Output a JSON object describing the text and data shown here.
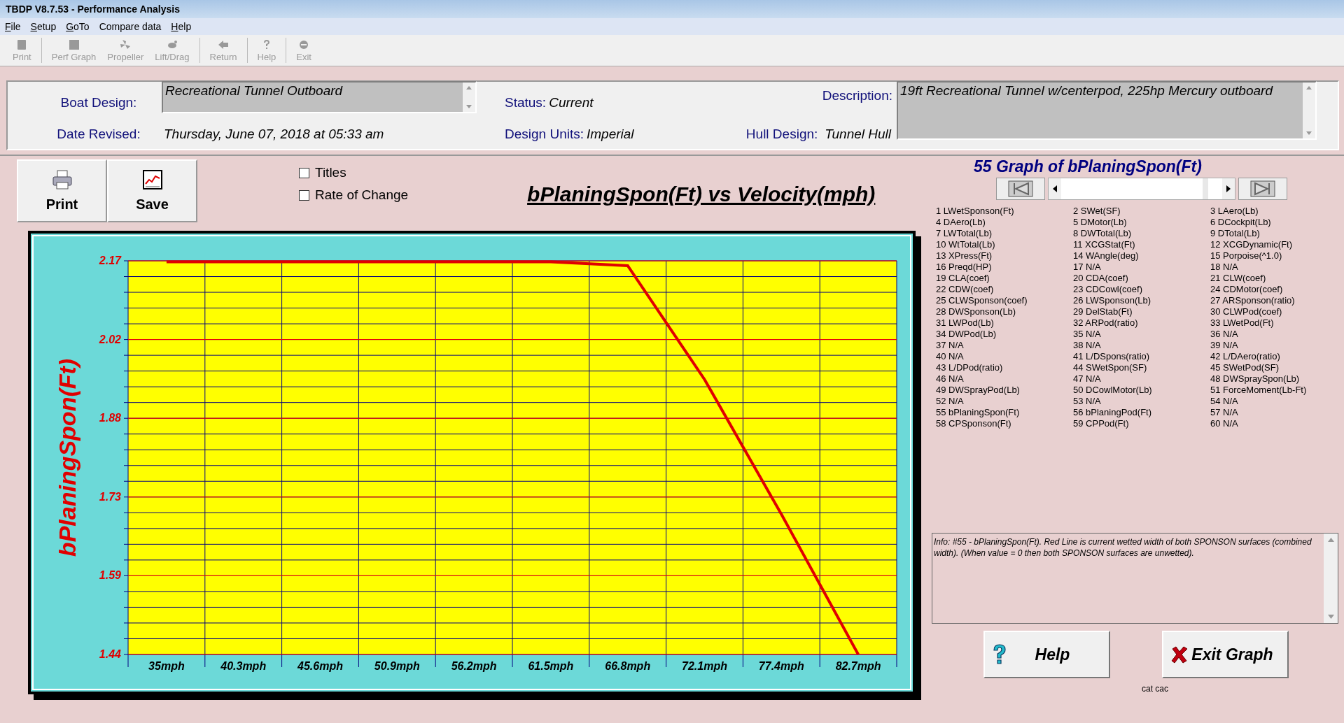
{
  "window": {
    "title": "TBDP V8.7.53 - Performance Analysis"
  },
  "menu": [
    {
      "label": "File",
      "mnemonic": true
    },
    {
      "label": "Setup",
      "mnemonic": true
    },
    {
      "label": "GoTo",
      "mnemonic": true
    },
    {
      "label": "Compare data",
      "mnemonic": false
    },
    {
      "label": "Help",
      "mnemonic": true
    }
  ],
  "toolbar": [
    {
      "label": "Print",
      "disabled": true
    },
    {
      "label": "Perf Graph",
      "disabled": true
    },
    {
      "label": "Propeller",
      "disabled": true
    },
    {
      "label": "Lift/Drag",
      "disabled": true
    },
    {
      "label": "Return",
      "disabled": true
    },
    {
      "label": "Help",
      "disabled": true
    },
    {
      "label": "Exit",
      "disabled": true
    }
  ],
  "header": {
    "boat_design": {
      "label": "Boat Design:",
      "value": "Recreational Tunnel Outboard"
    },
    "status": {
      "label": "Status:",
      "value": "Current"
    },
    "description": {
      "label": "Description:",
      "value": "19ft Recreational Tunnel w/centerpod, 225hp Mercury outboard"
    },
    "date_revised": {
      "label": "Date Revised:",
      "value": "Thursday, June 07, 2018 at 05:33 am"
    },
    "design_units": {
      "label": "Design Units:",
      "value": "Imperial"
    },
    "hull_design": {
      "label": "Hull Design:",
      "value": "Tunnel Hull"
    }
  },
  "graph_buttons": [
    "Print",
    "Save"
  ],
  "options": [
    {
      "label": "Titles",
      "checked": false
    },
    {
      "label": "Rate of Change",
      "checked": false
    }
  ],
  "chart_data": {
    "type": "line",
    "title": "bPlaningSpon(Ft) vs Velocity(mph)",
    "ylabel": "bPlaningSpon(Ft)",
    "categories": [
      "35mph",
      "40.3mph",
      "45.6mph",
      "50.9mph",
      "56.2mph",
      "61.5mph",
      "66.8mph",
      "72.1mph",
      "77.4mph",
      "82.7mph"
    ],
    "grid": true,
    "series": [
      {
        "color": "#e00000",
        "values": [
          2.168,
          2.168,
          2.168,
          2.168,
          2.168,
          2.168,
          2.161,
          1.95,
          1.7,
          1.44
        ]
      }
    ],
    "ylim": [
      1.44,
      2.17
    ],
    "yticks": [
      {
        "value": 2.17,
        "label": "2.17"
      },
      {
        "value": 2.024,
        "label": "2.02"
      },
      {
        "value": 1.878,
        "label": "1.88"
      },
      {
        "value": 1.732,
        "label": "1.73"
      },
      {
        "value": 1.586,
        "label": "1.59"
      },
      {
        "value": 1.44,
        "label": "1.44"
      }
    ]
  },
  "graph_selector": {
    "title": "55 Graph of bPlaningSpon(Ft)"
  },
  "parameters": [
    "1 LWetSponson(Ft)",
    "2 SWet(SF)",
    "3 LAero(Lb)",
    "4 DAero(Lb)",
    "5 DMotor(Lb)",
    "6 DCockpit(Lb)",
    "7 LWTotal(Lb)",
    "8 DWTotal(Lb)",
    "9 DTotal(Lb)",
    "10 WtTotal(Lb)",
    "11 XCGStat(Ft)",
    "12 XCGDynamic(Ft)",
    "13 XPress(Ft)",
    "14 WAngle(deg)",
    "15 Porpoise(^1.0)",
    "16 Preqd(HP)",
    "17 N/A",
    "18 N/A",
    "19 CLA(coef)",
    "20 CDA(coef)",
    "21 CLW(coef)",
    "22 CDW(coef)",
    "23 CDCowl(coef)",
    "24 CDMotor(coef)",
    "25 CLWSponson(coef)",
    "26 LWSponson(Lb)",
    "27 ARSponson(ratio)",
    "28 DWSponson(Lb)",
    "29 DelStab(Ft)",
    "30 CLWPod(coef)",
    "31 LWPod(Lb)",
    "32 ARPod(ratio)",
    "33 LWetPod(Ft)",
    "34 DWPod(Lb)",
    "35 N/A",
    "36 N/A",
    "37 N/A",
    "38 N/A",
    "39 N/A",
    "40 N/A",
    "41 L/DSpons(ratio)",
    "42 L/DAero(ratio)",
    "43 L/DPod(ratio)",
    "44 SWetSpon(SF)",
    "45 SWetPod(SF)",
    "46 N/A",
    "47 N/A",
    "48 DWSpraySpon(Lb)",
    "49 DWSprayPod(Lb)",
    "50 DCowlMotor(Lb)",
    "51 ForceMoment(Lb-Ft)",
    "52 N/A",
    "53 N/A",
    "54 N/A",
    "55 bPlaningSpon(Ft)",
    "56 bPlaningPod(Ft)",
    "57 N/A",
    "58 CPSponson(Ft)",
    "59 CPPod(Ft)",
    "60 N/A"
  ],
  "info": "Info: #55 - bPlaningSpon(Ft). Red Line is current wetted width of both SPONSON surfaces (combined width). (When value = 0 then both SPONSON surfaces are unwetted).",
  "action_buttons": [
    "Help",
    "Exit Graph"
  ],
  "footnote": "cat cac"
}
